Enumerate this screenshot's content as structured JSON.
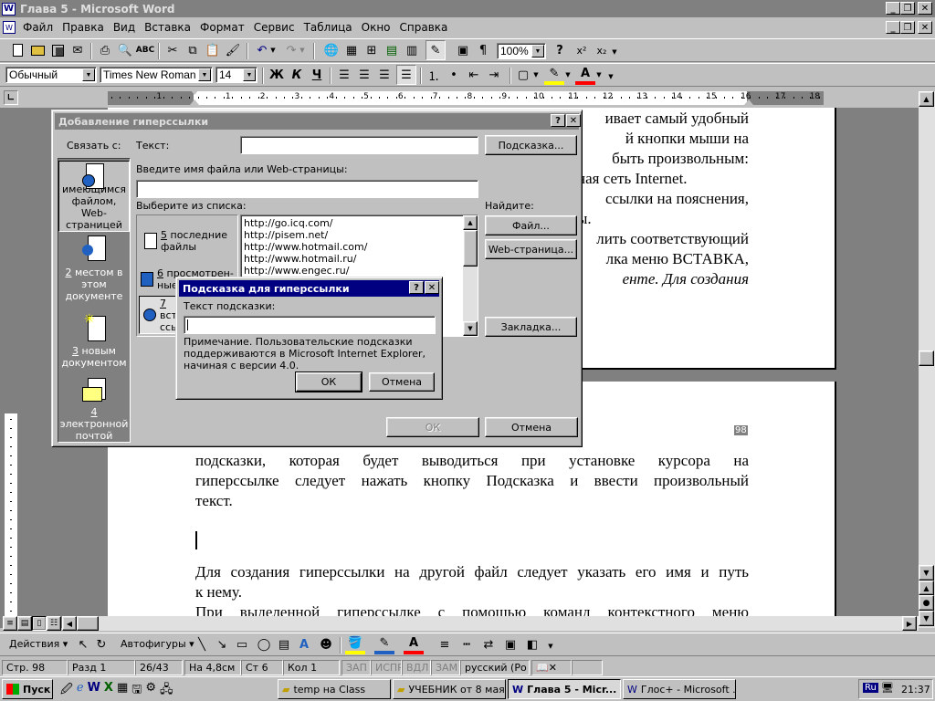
{
  "window": {
    "title": "Глава 5 - Microsoft Word"
  },
  "menu": [
    "Файл",
    "Правка",
    "Вид",
    "Вставка",
    "Формат",
    "Сервис",
    "Таблица",
    "Окно",
    "Справка"
  ],
  "toolbar": {
    "zoom": "100%"
  },
  "format": {
    "style": "Обычный",
    "font": "Times New Roman",
    "size": "14"
  },
  "ruler": {
    "numbers": [
      "1",
      "1",
      "2",
      "3",
      "4",
      "5",
      "6",
      "7",
      "8",
      "9",
      "10",
      "11",
      "12",
      "13",
      "14",
      "15",
      "16",
      "17",
      "18"
    ]
  },
  "doc_top_right": [
    "ивает самый удобный",
    "й кнопки мыши на",
    "быть произвольным:",
    "ная сеть Internet.",
    "ссылки на пояснения,",
    "ы.",
    "лить соответствующий",
    "лка меню ВСТАВКА,",
    "енте. Для создания"
  ],
  "doc_page2": [
    "подсказки, которая будет выводиться при установке курсора на",
    "гиперссылке следует нажать кнопку Подсказка и ввести произвольный",
    "текст.",
    "Для создания гиперссылки на другой файл следует указать его имя и путь",
    "к нему.",
    "При выделенной гиперссылке с помощью команд контекстного меню"
  ],
  "page_num_fragment": "98",
  "hyperlink_dialog": {
    "title": "Добавление гиперссылки",
    "link_to": "Связать с:",
    "link_types": [
      {
        "n": "1",
        "label": "имеющимся файлом, Web-страницей"
      },
      {
        "n": "2",
        "label": "местом в этом документе"
      },
      {
        "n": "3",
        "label": "новым документом"
      },
      {
        "n": "4",
        "label": "электронной почтой"
      }
    ],
    "text_label": "Текст:",
    "text_value": "",
    "hint_button": "Подсказка...",
    "file_label": "Введите имя файла или Web-страницы:",
    "file_value": "",
    "choose_label": "Выберите из списка:",
    "find_label": "Найдите:",
    "categories": [
      {
        "n": "5",
        "label": "последние файлы"
      },
      {
        "n": "6",
        "label": "просмотрен-ные"
      },
      {
        "n": "7",
        "label": "вставленные ссылки"
      }
    ],
    "urls": [
      "http://go.icq.com/",
      "http://pisem.net/",
      "http://www.hotmail.com/",
      "http://www.hotmail.ru/",
      "http://www.engec.ru/"
    ],
    "file_button": "Файл...",
    "web_button": "Web-страница...",
    "bookmark_button": "Закладка...",
    "ok": "ОК",
    "cancel": "Отмена",
    "help": "?",
    "close": "✕"
  },
  "tip_dialog": {
    "title": "Подсказка для гиперссылки",
    "label": "Текст подсказки:",
    "value": "",
    "note": "Примечание. Пользовательские подсказки поддерживаются  в Microsoft Internet Explorer, начиная с версии 4.0.",
    "ok": "ОК",
    "cancel": "Отмена",
    "help": "?",
    "close": "✕"
  },
  "drawing": {
    "actions": "Действия",
    "autoshapes": "Автофигуры"
  },
  "status": {
    "page": "Стр. 98",
    "section": "Разд 1",
    "pages": "26/43",
    "at": "На 4,8см",
    "line": "Ст 6",
    "col": "Кол 1",
    "rec": "ЗАП",
    "trk": "ИСПР",
    "ext": "ВДЛ",
    "ovr": "ЗАМ",
    "lang": "русский (Ро"
  },
  "taskbar": {
    "start": "Пуск",
    "tasks": [
      "temp на Class",
      "УЧЕБНИК от 8 мая",
      "Глава 5 - Micr...",
      "Глос+ - Microsoft ..."
    ],
    "lang": "Ru",
    "clock": "21:37"
  },
  "colors": {
    "title_active": "#000080",
    "title_inactive": "#808080",
    "highlight": "#ffff00",
    "font_color": "#ff0000"
  }
}
